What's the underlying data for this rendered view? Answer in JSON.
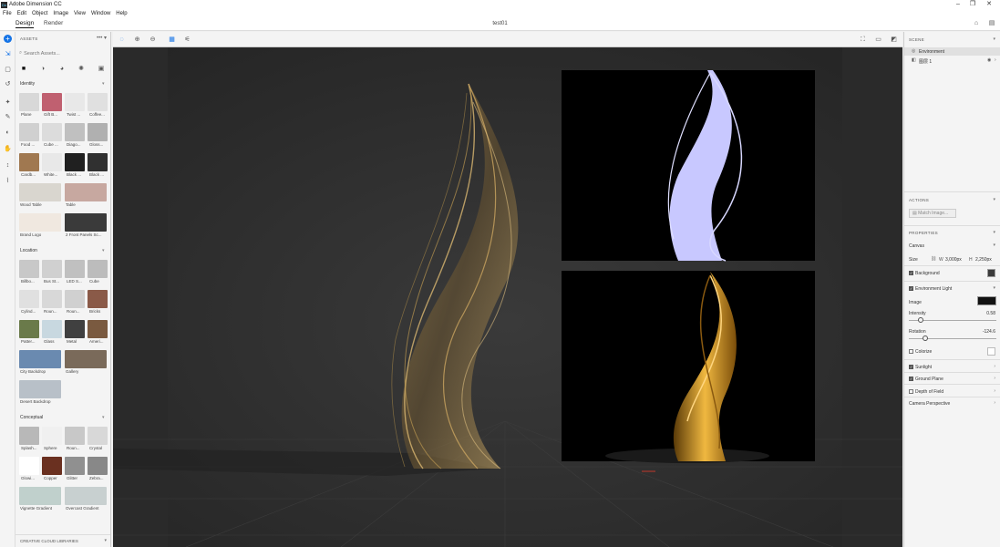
{
  "app": {
    "name": "Adobe Dimension CC",
    "logo_text": "Dn"
  },
  "window_controls": {
    "minimize": "–",
    "restore": "❐",
    "close": "✕"
  },
  "menu": [
    "File",
    "Edit",
    "Object",
    "Image",
    "View",
    "Window",
    "Help"
  ],
  "tabs": {
    "design": "Design",
    "render": "Render"
  },
  "document": {
    "title": "test01"
  },
  "assets": {
    "header": "ASSETS",
    "menu": "•••",
    "search_placeholder": "Search Assets...",
    "sections": {
      "identity": {
        "title": "Identity",
        "items": [
          "Plane",
          "Gift B...",
          "Twist ...",
          "Coffee...",
          "Food ...",
          "Cube ...",
          "Diago...",
          "Gloss...",
          "Cardb...",
          "White...",
          "Black ...",
          "Black ..."
        ],
        "wide": [
          "Wood Table",
          "Table",
          "Brand Logo",
          "2 Front Panels Sc..."
        ]
      },
      "location": {
        "title": "Location",
        "items": [
          "Billbo...",
          "Bus St...",
          "LED S...",
          "Cube",
          "Cylind...",
          "Roun...",
          "Roun...",
          "Bricks",
          "Patter...",
          "Glass",
          "Metal",
          "Ameri..."
        ],
        "wide": [
          "City Backdrop",
          "Gallery",
          "Desert Backdrop"
        ]
      },
      "conceptual": {
        "title": "Conceptual",
        "items": [
          "Splash...",
          "Sphere",
          "Roun...",
          "Crystal",
          "Glowi...",
          "Copper",
          "Glitter",
          "Zebra..."
        ],
        "wide": [
          "Vignette Gradient",
          "Overcast Gradient"
        ]
      }
    },
    "libraries": "CREATIVE CLOUD LIBRARIES"
  },
  "scene": {
    "header": "SCENE",
    "items": [
      "Environment",
      "图层 1"
    ]
  },
  "actions": {
    "header": "ACTIONS",
    "match_image": "Match Image..."
  },
  "properties": {
    "header": "PROPERTIES",
    "canvas": "Canvas",
    "size_label": "Size",
    "w_label": "W",
    "w_value": "3,000px",
    "h_label": "H",
    "h_value": "2,250px",
    "background": "Background",
    "environment_light": "Environment Light",
    "image_label": "Image",
    "intensity_label": "Intensity",
    "intensity_value": "0.58",
    "intensity_fraction": 0.1,
    "rotation_label": "Rotation",
    "rotation_value": "-124.6",
    "rotation_fraction": 0.16,
    "colorize": "Colorize",
    "sunlight": "Sunlight",
    "ground_plane": "Ground Plane",
    "depth_of_field": "Depth of Field",
    "camera_perspective": "Camera Perspective"
  },
  "colors": {
    "accent": "#1473e6",
    "viewport": "#2f2f2f",
    "background_swatch": "#3a3a3a",
    "silhouette": "#c8c8ff"
  }
}
